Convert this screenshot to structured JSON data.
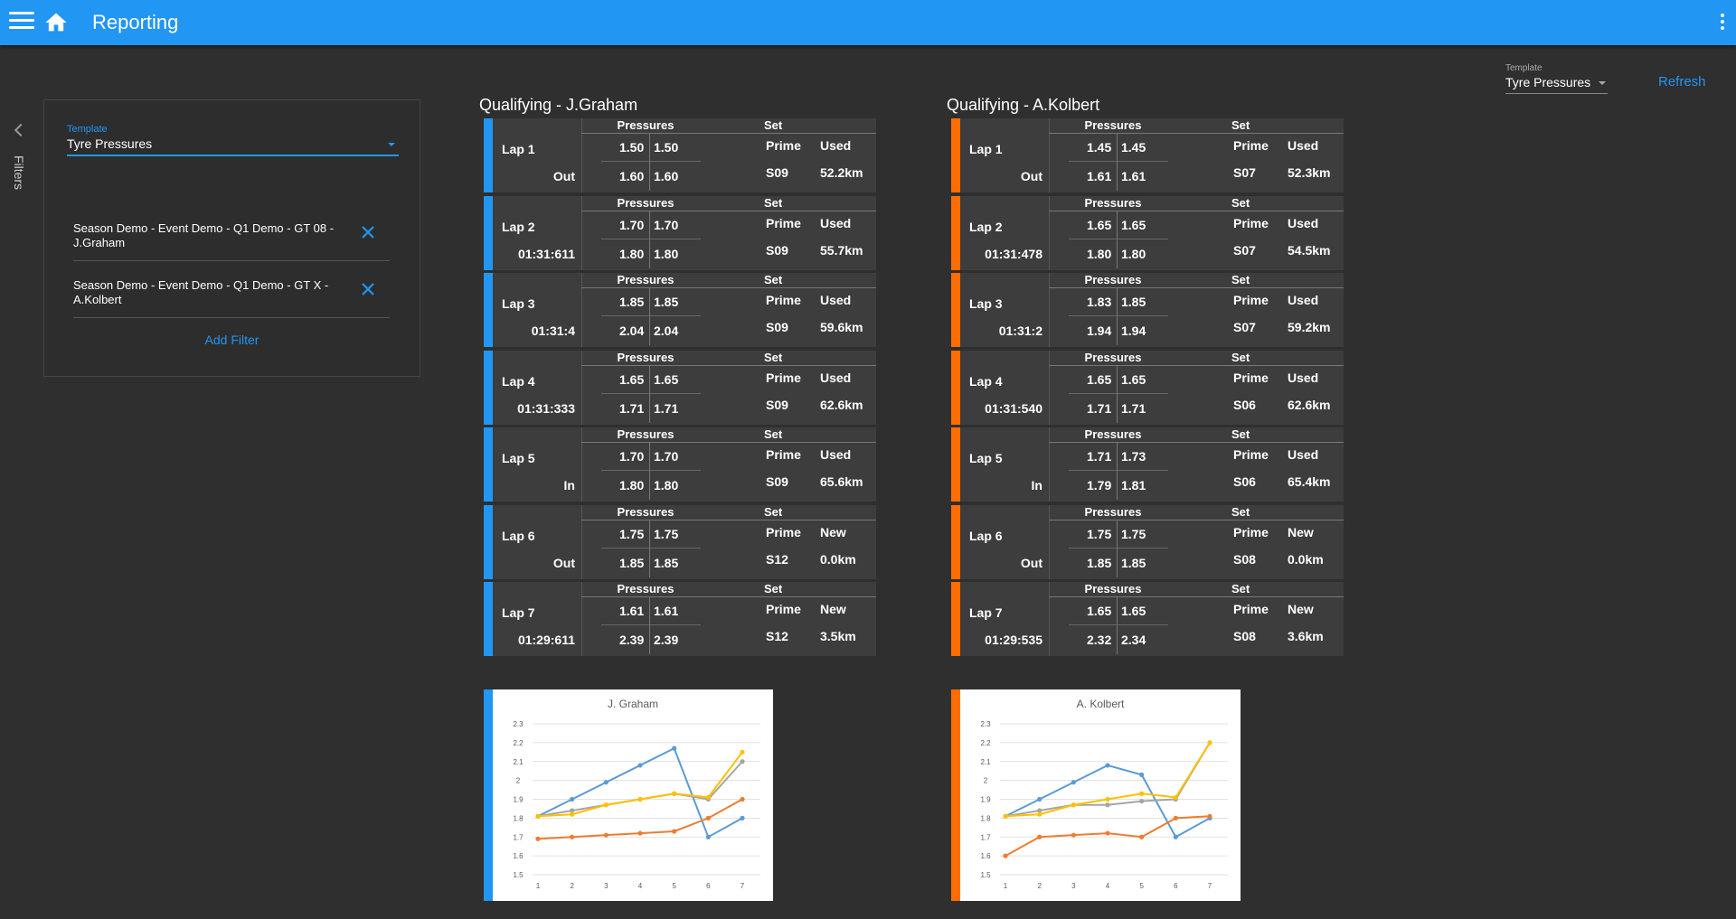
{
  "app": {
    "title": "Reporting"
  },
  "top": {
    "template_label": "Template",
    "template_value": "Tyre Pressures",
    "refresh_label": "Refresh"
  },
  "sidebar": {
    "filters_label": "Filters"
  },
  "filter_panel": {
    "template_label": "Template",
    "template_value": "Tyre Pressures",
    "filters": [
      {
        "text": "Season Demo - Event Demo - Q1 Demo - GT 08 - J.Graham"
      },
      {
        "text": "Season Demo - Event Demo - Q1 Demo - GT X - A.Kolbert"
      }
    ],
    "add_filter_label": "Add Filter"
  },
  "colors": {
    "appbar": "#2196f3",
    "driver1": "#2196f3",
    "driver2": "#ff6d00",
    "series_blue": "#5b9bd5",
    "series_orange": "#ed7d31",
    "series_gray": "#a5a5a5",
    "series_yellow": "#ffc000"
  },
  "headers": {
    "pressures": "Pressures",
    "set": "Set"
  },
  "drivers": [
    {
      "title": "Qualifying - J.Graham",
      "laps": [
        {
          "lap": "Lap 1",
          "time": "Out",
          "p": [
            "1.50",
            "1.50",
            "1.60",
            "1.60"
          ],
          "s": [
            "Prime",
            "Used",
            "S09",
            "52.2km"
          ]
        },
        {
          "lap": "Lap 2",
          "time": "01:31:611",
          "p": [
            "1.70",
            "1.70",
            "1.80",
            "1.80"
          ],
          "s": [
            "Prime",
            "Used",
            "S09",
            "55.7km"
          ]
        },
        {
          "lap": "Lap 3",
          "time": "01:31:4",
          "p": [
            "1.85",
            "1.85",
            "2.04",
            "2.04"
          ],
          "s": [
            "Prime",
            "Used",
            "S09",
            "59.6km"
          ]
        },
        {
          "lap": "Lap 4",
          "time": "01:31:333",
          "p": [
            "1.65",
            "1.65",
            "1.71",
            "1.71"
          ],
          "s": [
            "Prime",
            "Used",
            "S09",
            "62.6km"
          ]
        },
        {
          "lap": "Lap 5",
          "time": "In",
          "p": [
            "1.70",
            "1.70",
            "1.80",
            "1.80"
          ],
          "s": [
            "Prime",
            "Used",
            "S09",
            "65.6km"
          ]
        },
        {
          "lap": "Lap 6",
          "time": "Out",
          "p": [
            "1.75",
            "1.75",
            "1.85",
            "1.85"
          ],
          "s": [
            "Prime",
            "New",
            "S12",
            "0.0km"
          ]
        },
        {
          "lap": "Lap 7",
          "time": "01:29:611",
          "p": [
            "1.61",
            "1.61",
            "2.39",
            "2.39"
          ],
          "s": [
            "Prime",
            "New",
            "S12",
            "3.5km"
          ]
        }
      ]
    },
    {
      "title": "Qualifying - A.Kolbert",
      "laps": [
        {
          "lap": "Lap 1",
          "time": "Out",
          "p": [
            "1.45",
            "1.45",
            "1.61",
            "1.61"
          ],
          "s": [
            "Prime",
            "Used",
            "S07",
            "52.3km"
          ]
        },
        {
          "lap": "Lap 2",
          "time": "01:31:478",
          "p": [
            "1.65",
            "1.65",
            "1.80",
            "1.80"
          ],
          "s": [
            "Prime",
            "Used",
            "S07",
            "54.5km"
          ]
        },
        {
          "lap": "Lap 3",
          "time": "01:31:2",
          "p": [
            "1.83",
            "1.85",
            "1.94",
            "1.94"
          ],
          "s": [
            "Prime",
            "Used",
            "S07",
            "59.2km"
          ]
        },
        {
          "lap": "Lap 4",
          "time": "01:31:540",
          "p": [
            "1.65",
            "1.65",
            "1.71",
            "1.71"
          ],
          "s": [
            "Prime",
            "Used",
            "S06",
            "62.6km"
          ]
        },
        {
          "lap": "Lap 5",
          "time": "In",
          "p": [
            "1.71",
            "1.73",
            "1.79",
            "1.81"
          ],
          "s": [
            "Prime",
            "Used",
            "S06",
            "65.4km"
          ]
        },
        {
          "lap": "Lap 6",
          "time": "Out",
          "p": [
            "1.75",
            "1.75",
            "1.85",
            "1.85"
          ],
          "s": [
            "Prime",
            "New",
            "S08",
            "0.0km"
          ]
        },
        {
          "lap": "Lap 7",
          "time": "01:29:535",
          "p": [
            "1.65",
            "1.65",
            "2.32",
            "2.34"
          ],
          "s": [
            "Prime",
            "New",
            "S08",
            "3.6km"
          ]
        }
      ]
    }
  ],
  "chart_data": [
    {
      "type": "line",
      "title": "J. Graham",
      "x": [
        1,
        2,
        3,
        4,
        5,
        6,
        7
      ],
      "ylim": [
        1.5,
        2.3
      ],
      "yticks": [
        "1.5",
        "1.6",
        "1.7",
        "1.8",
        "1.9",
        "2",
        "2.1",
        "2.2",
        "2.3"
      ],
      "grid": true,
      "series": [
        {
          "values": [
            1.81,
            1.9,
            1.99,
            2.08,
            2.17,
            1.7,
            1.8
          ]
        },
        {
          "values": [
            1.69,
            1.7,
            1.71,
            1.72,
            1.73,
            1.8,
            1.9
          ]
        },
        {
          "values": [
            1.81,
            1.84,
            1.87,
            1.9,
            1.93,
            1.9,
            2.1
          ]
        },
        {
          "values": [
            1.81,
            1.82,
            1.87,
            1.9,
            1.93,
            1.91,
            2.15
          ]
        }
      ]
    },
    {
      "type": "line",
      "title": "A. Kolbert",
      "x": [
        1,
        2,
        3,
        4,
        5,
        6,
        7
      ],
      "ylim": [
        1.5,
        2.3
      ],
      "yticks": [
        "1.5",
        "1.6",
        "1.7",
        "1.8",
        "1.9",
        "2",
        "2.1",
        "2.2",
        "2.3"
      ],
      "grid": true,
      "series": [
        {
          "values": [
            1.81,
            1.9,
            1.99,
            2.08,
            2.03,
            1.7,
            1.8
          ]
        },
        {
          "values": [
            1.6,
            1.7,
            1.71,
            1.72,
            1.7,
            1.8,
            1.81
          ]
        },
        {
          "values": [
            1.81,
            1.84,
            1.87,
            1.87,
            1.89,
            1.9,
            2.2
          ]
        },
        {
          "values": [
            1.81,
            1.82,
            1.87,
            1.9,
            1.93,
            1.91,
            2.2
          ]
        }
      ]
    }
  ]
}
